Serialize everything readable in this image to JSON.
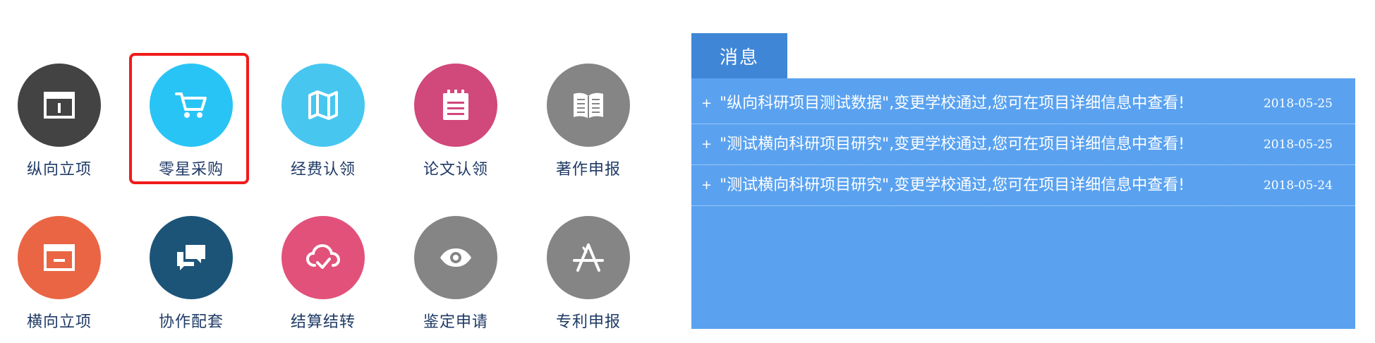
{
  "tiles": [
    {
      "label": "纵向立项",
      "icon": "browser-window-icon",
      "color": "#434343"
    },
    {
      "label": "零星采购",
      "icon": "shopping-cart-icon",
      "color": "#29c4f6"
    },
    {
      "label": "经费认领",
      "icon": "folded-map-icon",
      "color": "#47c6f0"
    },
    {
      "label": "论文认领",
      "icon": "notepad-icon",
      "color": "#d1487a"
    },
    {
      "label": "著作申报",
      "icon": "open-book-icon",
      "color": "#858585"
    },
    {
      "label": "横向立项",
      "icon": "browser-minimize-icon",
      "color": "#ea6544"
    },
    {
      "label": "协作配套",
      "icon": "chat-bubbles-icon",
      "color": "#1c5478"
    },
    {
      "label": "结算结转",
      "icon": "cloud-check-icon",
      "color": "#e2517a"
    },
    {
      "label": "鉴定申请",
      "icon": "eye-icon",
      "color": "#858585"
    },
    {
      "label": "专利申报",
      "icon": "app-store-icon",
      "color": "#858585"
    }
  ],
  "highlighted_tile": "零星采购",
  "messages": {
    "tab_label": "消息",
    "items": [
      {
        "text": "\"纵向科研项目测试数据\",变更学校通过,您可在项目详细信息中查看!",
        "date": "2018-05-25"
      },
      {
        "text": "\"测试横向科研项目研究\",变更学校通过,您可在项目详细信息中查看!",
        "date": "2018-05-25"
      },
      {
        "text": "\"测试横向科研项目研究\",变更学校通过,您可在项目详细信息中查看!",
        "date": "2018-05-24"
      }
    ]
  },
  "colors": {
    "label_text": "#1f3a66",
    "highlight_border": "#f01b1b",
    "tab_bg": "#3f86d6",
    "panel_bg": "#5aa2f0"
  }
}
